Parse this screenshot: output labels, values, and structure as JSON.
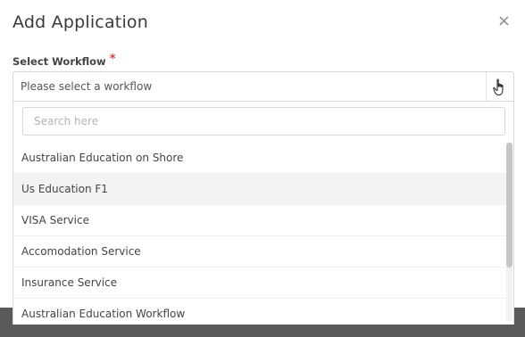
{
  "dialog": {
    "title": "Add Application",
    "close_glyph": "×"
  },
  "workflow_field": {
    "label": "Select Workflow",
    "required_marker": "*",
    "selected_value": "Please select a workflow",
    "search_placeholder": "Search here",
    "options": [
      "Australian Education on Shore",
      "Us Education F1",
      "VISA Service",
      "Accomodation Service",
      "Insurance Service",
      "Australian Education Workflow"
    ],
    "hovered_index": 1
  },
  "icons": {
    "close": "close-icon",
    "cursor": "hand-cursor-icon"
  },
  "colors": {
    "required": "#e03a3a",
    "overlay": "#5a5a5a",
    "hover_row": "#f3f3f3"
  }
}
